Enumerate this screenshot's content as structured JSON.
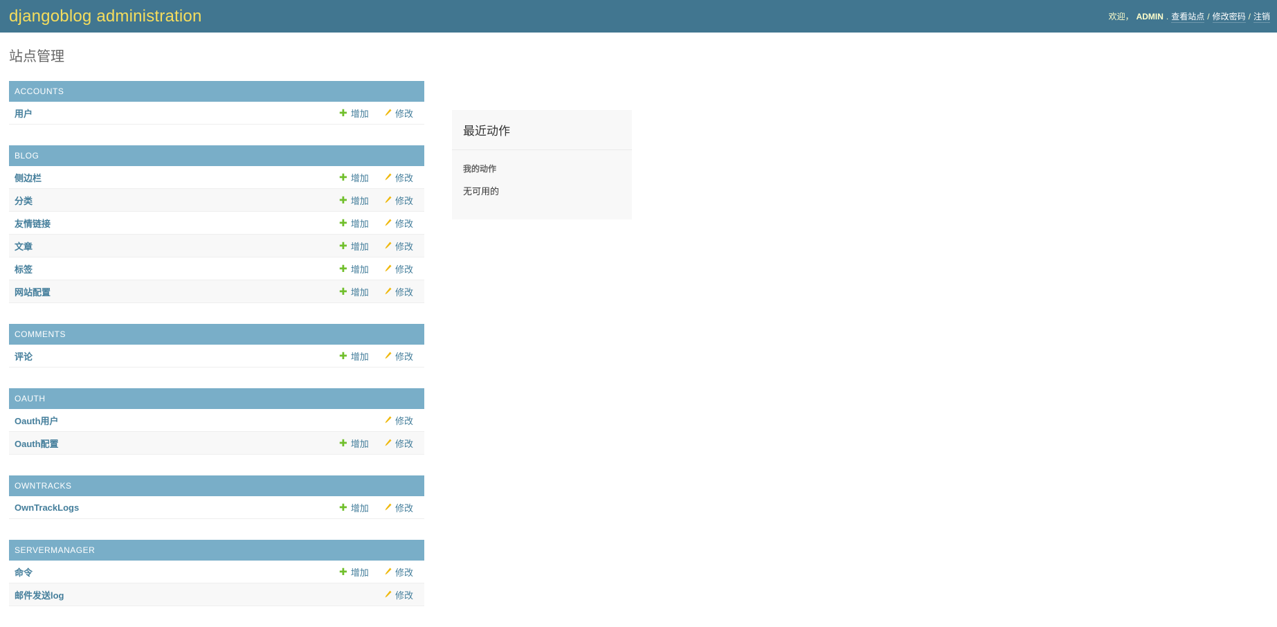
{
  "header": {
    "branding": "djangoblog administration",
    "welcome": "欢迎，",
    "username": "ADMIN",
    "username_suffix": ".",
    "view_site": "查看站点",
    "separator": "/",
    "change_password": "修改密码",
    "logout": "注销"
  },
  "page": {
    "title": "站点管理"
  },
  "modules": {
    "accounts": {
      "caption": "ACCOUNTS",
      "models": [
        {
          "name": "用户"
        }
      ]
    },
    "blog": {
      "caption": "BLOG",
      "models": [
        {
          "name": "侧边栏"
        },
        {
          "name": "分类"
        },
        {
          "name": "友情链接"
        },
        {
          "name": "文章"
        },
        {
          "name": "标签"
        },
        {
          "name": "网站配置"
        }
      ]
    },
    "comments": {
      "caption": "COMMENTS",
      "models": [
        {
          "name": "评论"
        }
      ]
    },
    "oauth": {
      "caption": "OAUTH",
      "models": [
        {
          "name": "Oauth用户"
        },
        {
          "name": "Oauth配置"
        }
      ]
    },
    "owntracks": {
      "caption": "OWNTRACKS",
      "models": [
        {
          "name": "OwnTrackLogs"
        }
      ]
    },
    "servermanager": {
      "caption": "SERVERMANAGER",
      "models": [
        {
          "name": "命令"
        },
        {
          "name": "邮件发送log"
        }
      ]
    }
  },
  "actions": {
    "add_label": "增加",
    "change_label": "修改",
    "add_icon": "plus-icon",
    "change_icon": "pencil-icon"
  },
  "recent_actions": {
    "title": "最近动作",
    "subtitle": "我的动作",
    "empty": "无可用的"
  },
  "colors": {
    "header_bg": "#417690",
    "branding": "#f5dd5d",
    "caption_bg": "#79aec8",
    "link": "#447e9b",
    "add_green": "#70bf2b",
    "change_yellow": "#efb80b"
  }
}
